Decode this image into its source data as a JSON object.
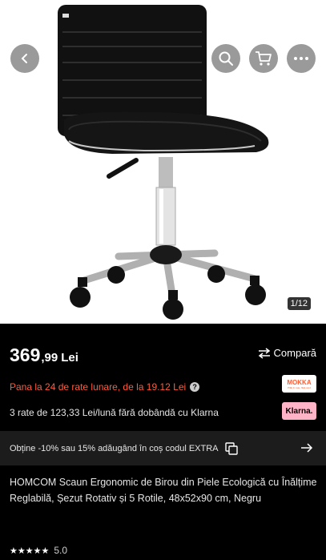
{
  "gallery": {
    "image_alt": "product-image-office-chair",
    "counter": "1/12"
  },
  "icons": {
    "back": "chevron-left-icon",
    "search": "search-icon",
    "cart": "cart-icon",
    "more": "more-icon"
  },
  "price": {
    "integer": "369",
    "decimal": ",99",
    "currency": "Lei"
  },
  "compare_label": "Compară",
  "installments": {
    "text": "Pana la 24 de rate lunare, de la 19.12 Lei",
    "help": "?",
    "provider": "MOKKA",
    "provider_sub": "Plăți în rate, fără card"
  },
  "klarna": {
    "text": "3 rate de 123,33 Lei/lună fără dobândă cu Klarna",
    "logo": "Klarna."
  },
  "promo": {
    "text": "Obține -10% sau 15% adăugând în coș codul EXTRA"
  },
  "product": {
    "title": "HOMCOM Scaun Ergonomic de Birou din Piele Ecologică cu Înălțime Reglabilă, Șezut Rotativ și 5 Rotile, 48x52x90 cm, Negru"
  },
  "rating": {
    "stars": 5,
    "value": "5.0"
  },
  "colors": {
    "accent": "#ff5a3c",
    "klarna": "#ffb3c7",
    "background": "#000000"
  }
}
